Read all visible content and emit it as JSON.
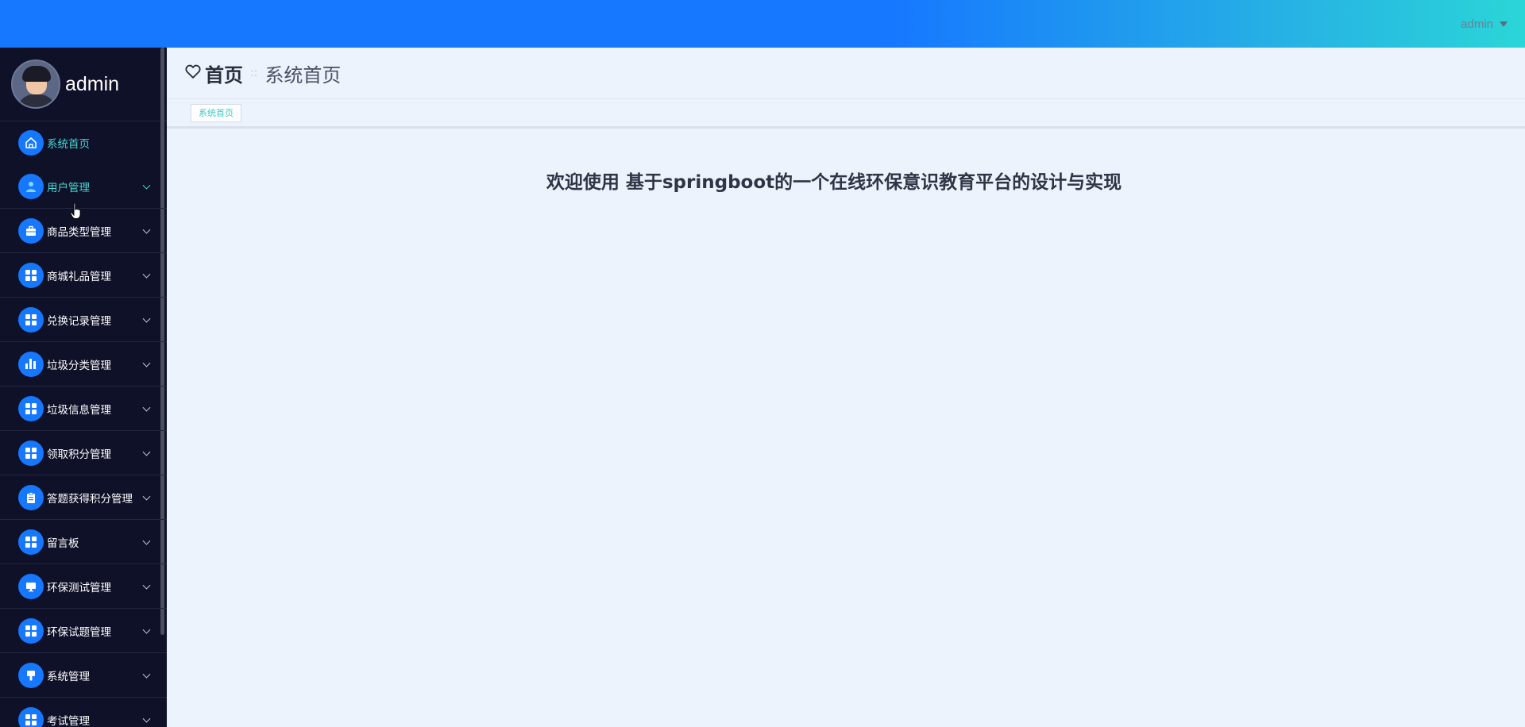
{
  "header": {
    "user_label": "admin"
  },
  "sidebar": {
    "profile_name": "admin",
    "items": [
      {
        "label": "系统首页",
        "icon": "home-icon",
        "active": true
      },
      {
        "label": "用户管理",
        "icon": "user-icon",
        "active": true
      },
      {
        "label": "商品类型管理",
        "icon": "briefcase-icon"
      },
      {
        "label": "商城礼品管理",
        "icon": "grid-icon"
      },
      {
        "label": "兑换记录管理",
        "icon": "grid-icon"
      },
      {
        "label": "垃圾分类管理",
        "icon": "bar-chart-icon"
      },
      {
        "label": "垃圾信息管理",
        "icon": "grid-icon"
      },
      {
        "label": "领取积分管理",
        "icon": "grid-icon"
      },
      {
        "label": "答题获得积分管理",
        "icon": "clipboard-icon"
      },
      {
        "label": "留言板",
        "icon": "grid-icon"
      },
      {
        "label": "环保测试管理",
        "icon": "monitor-icon"
      },
      {
        "label": "环保试题管理",
        "icon": "grid-icon"
      },
      {
        "label": "系统管理",
        "icon": "brush-icon"
      },
      {
        "label": "考试管理",
        "icon": "grid-icon"
      }
    ]
  },
  "breadcrumb": {
    "home": "首页",
    "separator": "::",
    "current": "系统首页"
  },
  "tabs": {
    "open": [
      "系统首页"
    ]
  },
  "main": {
    "welcome": "欢迎使用 基于springboot的一个在线环保意识教育平台的设计与实现"
  },
  "colors": {
    "primary": "#1677ff",
    "accent": "#46d7d2",
    "sidebar_bg": "#0f1129",
    "main_bg": "#edf3fc"
  }
}
